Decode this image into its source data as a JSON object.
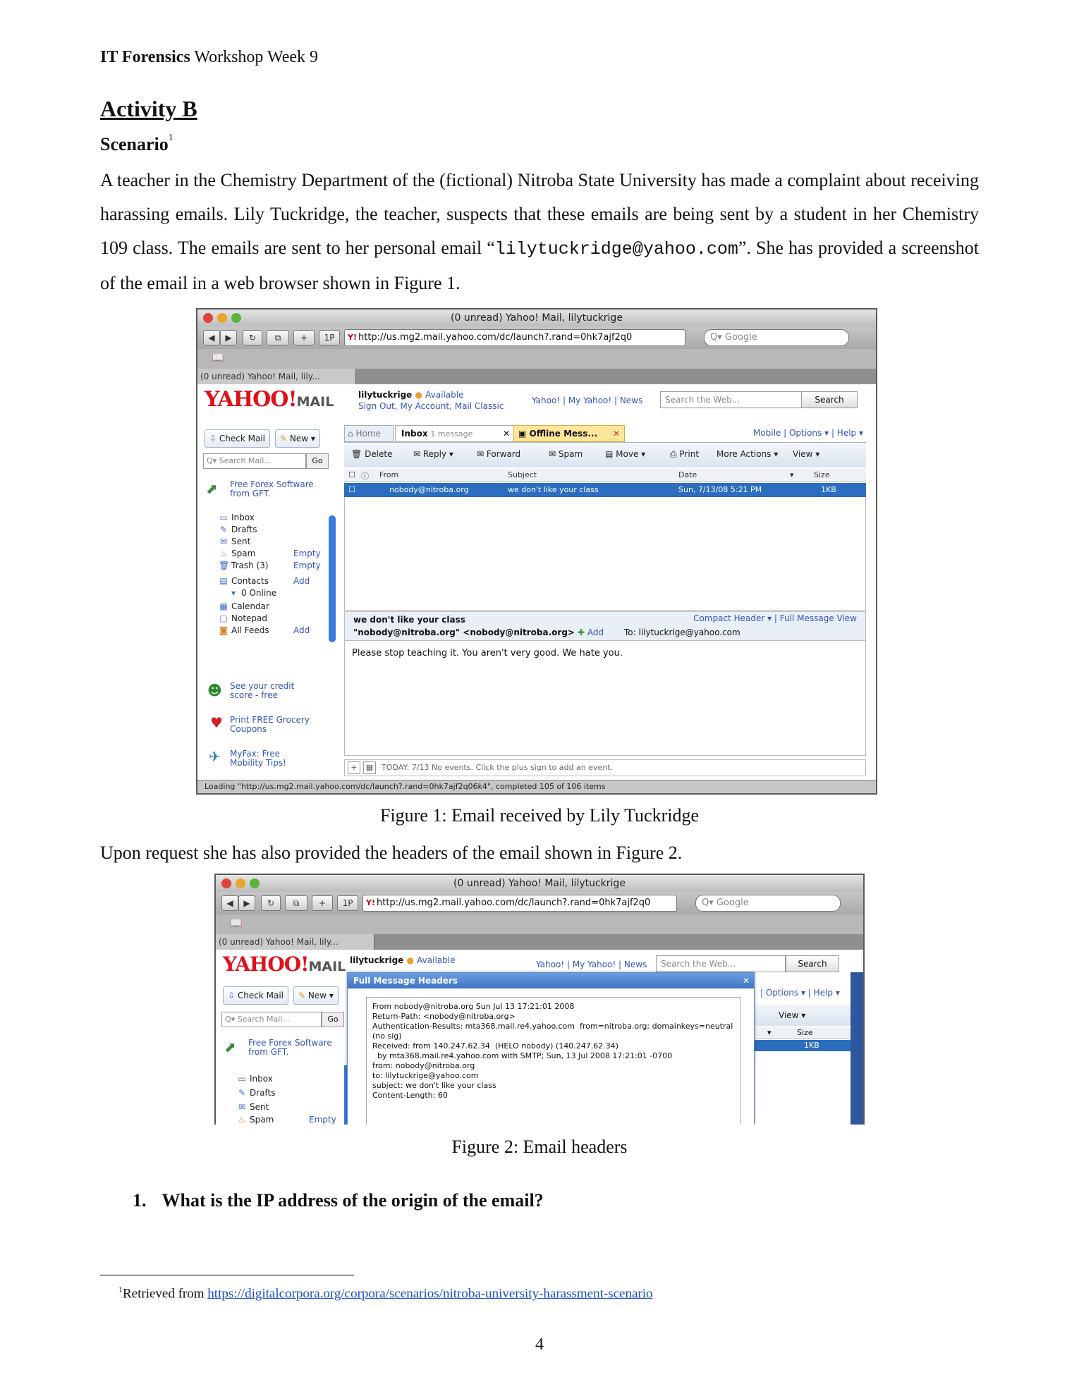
{
  "header": {
    "bold": "IT Forensics",
    "rest": " Workshop Week 9"
  },
  "activity_title": "Activity B",
  "scenario": {
    "label": "Scenario",
    "footnote_mark": "1"
  },
  "paragraph1": {
    "before": "A teacher in the Chemistry Department of the (fictional) Nitroba State University has made a complaint about receiving harassing emails. Lily Tuckridge, the teacher, suspects that these emails are being sent by a student in her Chemistry 109 class. The emails are sent to her personal email “",
    "email": "lilytuckridge@yahoo.com",
    "after": "”. She has provided a screenshot of the email in a web browser shown in Figure 1."
  },
  "figure1": {
    "window_title": "(0 unread) Yahoo! Mail, lilytuckrige",
    "url": "http://us.mg2.mail.yahoo.com/dc/launch?.rand=0hk7ajf2q0",
    "google_placeholder": "Google",
    "tab_label": "(0 unread) Yahoo! Mail, lily...",
    "logo": "YAHOO!",
    "logo_suffix": "MAIL",
    "user": "lilytuckrige",
    "status": "Available",
    "user_links": "Sign Out, My Account, Mail Classic",
    "top_links": "Yahoo! | My Yahoo! | News",
    "search_placeholder": "Search the Web...",
    "search_button": "Search",
    "check_mail": "Check Mail",
    "new": "New",
    "search_mail": "Search Mail...",
    "go": "Go",
    "ad1": "Free Forex Software from GFT.",
    "folders": [
      {
        "icon": "inbox-icon",
        "label": "Inbox",
        "action": ""
      },
      {
        "icon": "drafts-icon",
        "label": "Drafts",
        "action": ""
      },
      {
        "icon": "sent-icon",
        "label": "Sent",
        "action": ""
      },
      {
        "icon": "spam-icon",
        "label": "Spam",
        "action": "Empty"
      },
      {
        "icon": "trash-icon",
        "label": "Trash (3)",
        "action": "Empty"
      },
      {
        "icon": "contacts-icon",
        "label": "Contacts",
        "action": "Add"
      },
      {
        "icon": "online-icon",
        "label": "0 Online",
        "action": ""
      },
      {
        "icon": "calendar-icon",
        "label": "Calendar",
        "action": ""
      },
      {
        "icon": "notepad-icon",
        "label": "Notepad",
        "action": ""
      },
      {
        "icon": "feeds-icon",
        "label": "All Feeds",
        "action": "Add"
      }
    ],
    "ad2": "See your credit score - free",
    "ad3": "Print FREE Grocery Coupons",
    "ad4": "MyFax: Free Mobility Tips!",
    "tabs": {
      "home": "Home",
      "inbox": "Inbox",
      "inbox_count": "1 message",
      "offline": "Offline Mess..."
    },
    "right_links": "Mobile | Options ▾ | Help ▾",
    "actions": [
      "Delete",
      "Reply ▾",
      "Forward",
      "Spam",
      "Move ▾",
      "Print",
      "More Actions ▾",
      "View ▾"
    ],
    "columns": {
      "from": "From",
      "subject": "Subject",
      "date": "Date",
      "size": "Size"
    },
    "message": {
      "from": "nobody@nitroba.org",
      "subject": "we don't like your class",
      "date": "Sun, 7/13/08 5:21 PM",
      "size": "1KB"
    },
    "preview": {
      "subject": "we don't like your class",
      "sender": "\"nobody@nitroba.org\" <nobody@nitroba.org>",
      "add": "Add",
      "to": "To:  lilytuckrige@yahoo.com",
      "header_links": "Compact Header ▾ | Full Message View",
      "body": "Please stop teaching it. You aren't very good. We hate you."
    },
    "calendar_bar": "TODAY: 7/13  No events. Click the plus sign to add an event.",
    "status_bar": "Loading \"http://us.mg2.mail.yahoo.com/dc/launch?.rand=0hk7ajf2q06k4\", completed 105 of 106 items"
  },
  "caption1": "Figure 1: Email received by Lily Tuckridge",
  "paragraph2": "Upon request she has also provided the headers of the email shown in Figure 2.",
  "figure2": {
    "window_title": "(0 unread) Yahoo! Mail, lilytuckrige",
    "url": "http://us.mg2.mail.yahoo.com/dc/launch?.rand=0hk7ajf2q0",
    "google_placeholder": "Google",
    "tab_label": "(0 unread) Yahoo! Mail, lily...",
    "user": "lilytuckrige",
    "status": "Available",
    "top_links": "Yahoo! | My Yahoo! | News",
    "search_placeholder": "Search the Web...",
    "search_button": "Search",
    "check_mail": "Check Mail",
    "new": "New",
    "search_mail": "Search Mail...",
    "go": "Go",
    "ad1": "Free Forex Software from GFT.",
    "folders": [
      "Inbox",
      "Drafts",
      "Sent",
      "Spam"
    ],
    "spam_action": "Empty",
    "right_links": "| Options ▾ | Help ▾",
    "view": "View ▾",
    "size_col": "Size",
    "size_val": "1KB",
    "modal_title": "Full Message Headers",
    "headers": "From nobody@nitroba.org Sun Jul 13 17:21:01 2008\nReturn-Path: <nobody@nitroba.org>\nAuthentication-Results: mta368.mail.re4.yahoo.com  from=nitroba.org; domainkeys=neutral\n(no sig)\nReceived: from 140.247.62.34  (HELO nobody) (140.247.62.34)\n  by mta368.mail.re4.yahoo.com with SMTP; Sun, 13 Jul 2008 17:21:01 -0700\nfrom: nobody@nitroba.org\nto: lilytuckrige@yahoo.com\nsubject: we don't like your class\nContent-Length: 60"
  },
  "caption2": "Figure 2: Email headers",
  "question": {
    "number": "1.",
    "text": "What is the IP address of the origin of the email?"
  },
  "footnote": {
    "mark": "1",
    "prefix": "Retrieved from ",
    "link": "https://digitalcorpora.org/corpora/scenarios/nitroba-university-harassment-scenario"
  },
  "page_number": "4"
}
